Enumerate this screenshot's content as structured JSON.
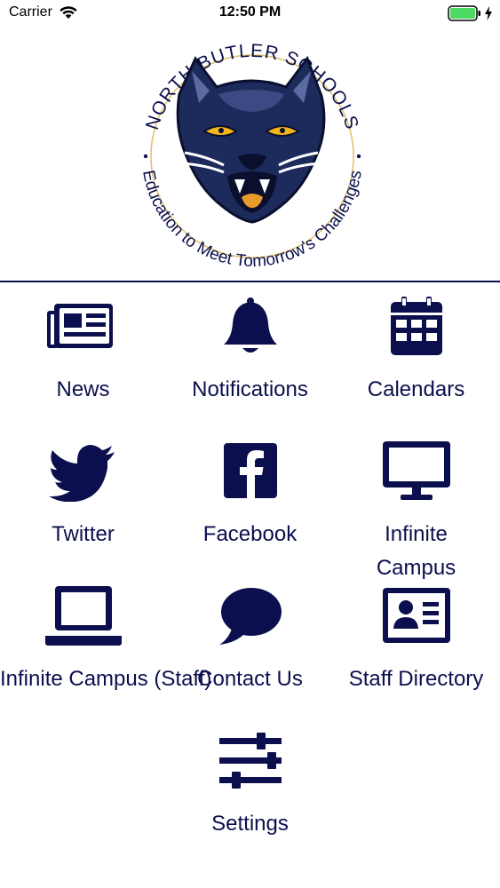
{
  "status_bar": {
    "carrier": "Carrier",
    "time": "12:50 PM",
    "wifi_icon": "wifi-icon",
    "battery_icon": "battery-icon",
    "charging_icon": "bolt-icon"
  },
  "logo": {
    "top_text": "NORTH BUTLER SCHOOLS",
    "bottom_text": "Education to Meet Tomorrow's Challenges",
    "icon": "panther-mascot-logo"
  },
  "colors": {
    "navy": "#0b0f4d",
    "battery_green": "#4cd964",
    "gold": "#e2c06a"
  },
  "menu": [
    {
      "label": "News",
      "icon": "newspaper-icon"
    },
    {
      "label": "Notifications",
      "icon": "bell-icon"
    },
    {
      "label": "Calendars",
      "icon": "calendar-icon"
    },
    {
      "label": "Twitter",
      "icon": "twitter-bird-icon"
    },
    {
      "label": "Facebook",
      "icon": "facebook-icon"
    },
    {
      "label": "Infinite\nCampus",
      "icon": "desktop-monitor-icon"
    },
    {
      "label": "Infinite\nCampus (Staff)",
      "icon": "laptop-icon"
    },
    {
      "label": "Contact Us",
      "icon": "speech-bubble-icon"
    },
    {
      "label": "Staff Directory",
      "icon": "id-card-icon"
    },
    {
      "label": "Settings",
      "icon": "sliders-icon"
    }
  ]
}
